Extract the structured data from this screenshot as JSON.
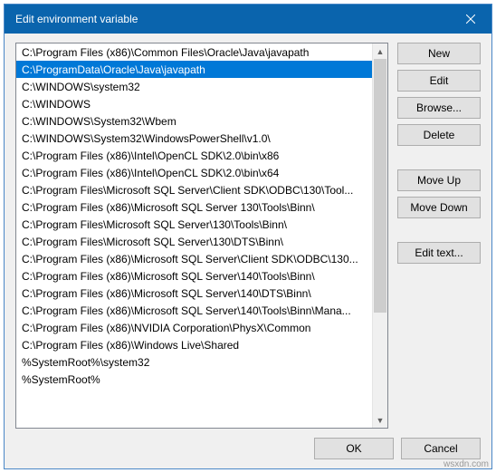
{
  "title": "Edit environment variable",
  "list_items": [
    "C:\\Program Files (x86)\\Common Files\\Oracle\\Java\\javapath",
    "C:\\ProgramData\\Oracle\\Java\\javapath",
    "C:\\WINDOWS\\system32",
    "C:\\WINDOWS",
    "C:\\WINDOWS\\System32\\Wbem",
    "C:\\WINDOWS\\System32\\WindowsPowerShell\\v1.0\\",
    "C:\\Program Files (x86)\\Intel\\OpenCL SDK\\2.0\\bin\\x86",
    "C:\\Program Files (x86)\\Intel\\OpenCL SDK\\2.0\\bin\\x64",
    "C:\\Program Files\\Microsoft SQL Server\\Client SDK\\ODBC\\130\\Tool...",
    "C:\\Program Files (x86)\\Microsoft SQL Server 130\\Tools\\Binn\\",
    "C:\\Program Files\\Microsoft SQL Server\\130\\Tools\\Binn\\",
    "C:\\Program Files\\Microsoft SQL Server\\130\\DTS\\Binn\\",
    "C:\\Program Files (x86)\\Microsoft SQL Server\\Client SDK\\ODBC\\130...",
    "C:\\Program Files (x86)\\Microsoft SQL Server\\140\\Tools\\Binn\\",
    "C:\\Program Files (x86)\\Microsoft SQL Server\\140\\DTS\\Binn\\",
    "C:\\Program Files (x86)\\Microsoft SQL Server\\140\\Tools\\Binn\\Mana...",
    "C:\\Program Files (x86)\\NVIDIA Corporation\\PhysX\\Common",
    "C:\\Program Files (x86)\\Windows Live\\Shared",
    "%SystemRoot%\\system32",
    "%SystemRoot%"
  ],
  "selected_index": 1,
  "buttons": {
    "new": "New",
    "edit": "Edit",
    "browse": "Browse...",
    "delete": "Delete",
    "move_up": "Move Up",
    "move_down": "Move Down",
    "edit_text": "Edit text...",
    "ok": "OK",
    "cancel": "Cancel"
  },
  "watermark": "wsxdn.com"
}
